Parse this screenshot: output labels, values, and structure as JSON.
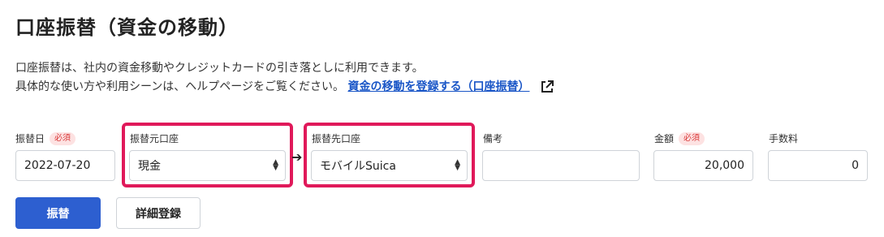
{
  "page": {
    "title": "口座振替（資金の移動）",
    "description_line1": "口座振替は、社内の資金移動やクレジットカードの引き落としに利用できます。",
    "description_line2": "具体的な使い方や利用シーンは、ヘルプページをご覧ください。",
    "help_link": "資金の移動を登録する（口座振替）"
  },
  "form": {
    "required_badge": "必須",
    "transfer_date": {
      "label": "振替日",
      "value": "2022-07-20"
    },
    "from_account": {
      "label": "振替元口座",
      "value": "現金"
    },
    "to_account": {
      "label": "振替先口座",
      "value": "モバイルSuica"
    },
    "memo": {
      "label": "備考",
      "value": ""
    },
    "amount": {
      "label": "金額",
      "value": "20,000"
    },
    "fee": {
      "label": "手数料",
      "value": "0"
    },
    "arrow": "➔"
  },
  "buttons": {
    "submit": "振替",
    "detail": "詳細登録"
  },
  "colors": {
    "highlight": "#e0195a",
    "primary": "#2d5fd0",
    "link": "#1a56c7",
    "required_bg": "#fde2e2",
    "required_text": "#d93838"
  },
  "icons": {
    "external_link": "external-link-icon",
    "select_arrows": "select-arrows-icon"
  }
}
